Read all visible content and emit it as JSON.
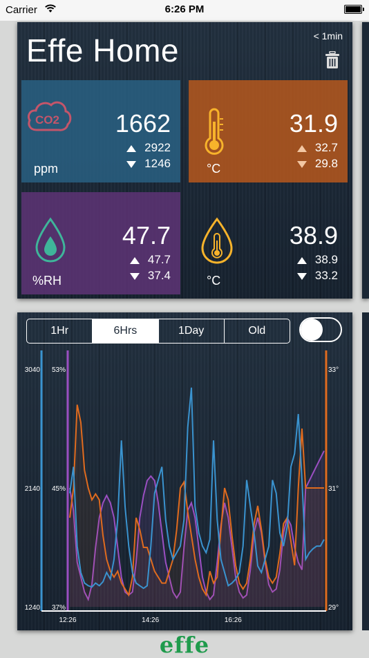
{
  "status": {
    "carrier": "Carrier",
    "time": "6:26 PM"
  },
  "app": {
    "title": "Effe Home",
    "refresh": "< 1min",
    "brand": "effe"
  },
  "tiles": {
    "co2": {
      "value": "1662",
      "high": "2922",
      "low": "1246",
      "unit": "ppm",
      "icon_label": "CO2"
    },
    "temp": {
      "value": "31.9",
      "high": "32.7",
      "low": "29.8",
      "unit": "°C"
    },
    "humidity": {
      "value": "47.7",
      "high": "47.7",
      "low": "37.4",
      "unit": "%RH"
    },
    "temp2": {
      "value": "38.9",
      "high": "38.9",
      "low": "33.2",
      "unit": "°C"
    }
  },
  "range": {
    "options": [
      "1Hr",
      "6Hrs",
      "1Day",
      "Old"
    ],
    "selected": "6Hrs"
  },
  "toggle": {
    "on": false
  },
  "colors": {
    "co2": "#3a93cf",
    "temp": "#e06b1e",
    "humidity": "#9b4fc2",
    "brand": "#1f9b4c"
  },
  "icons": [
    "wifi-icon",
    "battery-icon",
    "trash-icon",
    "co2-cloud-icon",
    "thermometer-icon",
    "water-drop-icon",
    "thermometer-drop-icon"
  ],
  "chart_data": {
    "type": "line",
    "y_left_co2": {
      "ticks": [
        "3040",
        "2140",
        "1240"
      ],
      "range": [
        1240,
        3040
      ]
    },
    "y_left_rh": {
      "ticks": [
        "53%",
        "45%",
        "37%"
      ],
      "range": [
        37,
        53
      ]
    },
    "y_right_temp": {
      "ticks": [
        "33°",
        "31°",
        "29°"
      ],
      "range": [
        29,
        33
      ]
    },
    "x_ticks": [
      "12:26",
      "14:26",
      "16:26"
    ],
    "series": [
      {
        "color": "#3a93cf",
        "values": [
          2100,
          2300,
          1700,
          1500,
          1420,
          1400,
          1390,
          1420,
          1400,
          1430,
          1500,
          1450,
          1600,
          1900,
          2500,
          2000,
          1700,
          1500,
          1420,
          1400,
          1380,
          1400,
          1700,
          2100,
          2200,
          2300,
          1900,
          1700,
          1600,
          1650,
          1700,
          1900,
          2600,
          2900,
          2000,
          1800,
          1700,
          1650,
          1750,
          2500,
          1900,
          1600,
          1500,
          1400,
          1420,
          1450,
          1500,
          1700,
          2200,
          2000,
          1800,
          1550,
          1500,
          1600,
          1700,
          2200,
          2100,
          1800,
          1700,
          1850,
          2300,
          2400,
          2700,
          2200,
          1600,
          1650,
          1680,
          1700,
          1700,
          1750
        ]
      },
      {
        "color": "#9b4fc2",
        "values": [
          45.0,
          43.5,
          40.0,
          39.0,
          38.0,
          37.5,
          38.5,
          41.0,
          43.0,
          44.0,
          44.5,
          44.0,
          43.0,
          41.0,
          39.0,
          38.0,
          37.8,
          38.0,
          40.0,
          43.0,
          44.5,
          45.5,
          45.8,
          45.5,
          44.0,
          42.0,
          40.0,
          39.0,
          38.0,
          37.6,
          38.0,
          41.0,
          43.5,
          44.0,
          43.0,
          41.0,
          39.0,
          38.0,
          37.5,
          37.8,
          40.0,
          42.5,
          44.0,
          43.0,
          41.0,
          39.0,
          38.0,
          37.6,
          37.8,
          39.5,
          42.0,
          43.0,
          42.0,
          40.0,
          38.5,
          38.0,
          38.2,
          39.5,
          42.0,
          43.0,
          42.5,
          41.0,
          40.0,
          39.5,
          45.0,
          45.5,
          46.0,
          46.5,
          47.0,
          47.5
        ]
      },
      {
        "color": "#e06b1e",
        "values": [
          30.5,
          31.0,
          32.4,
          32.1,
          31.3,
          31.0,
          30.8,
          30.9,
          30.8,
          30.2,
          29.8,
          29.6,
          29.5,
          29.6,
          29.4,
          29.3,
          29.2,
          29.5,
          30.5,
          30.3,
          30.0,
          30.0,
          29.8,
          29.6,
          29.5,
          29.4,
          29.4,
          29.6,
          29.8,
          30.3,
          31.0,
          31.1,
          30.6,
          30.2,
          29.8,
          29.5,
          29.3,
          29.2,
          29.6,
          29.4,
          29.5,
          30.3,
          31.0,
          30.8,
          30.2,
          29.7,
          29.4,
          29.3,
          29.4,
          29.8,
          30.4,
          30.7,
          30.3,
          29.8,
          29.5,
          29.4,
          29.5,
          29.9,
          30.4,
          30.5,
          30.1,
          29.7,
          31.0,
          32.0,
          31.0,
          31.0,
          31.0,
          31.0,
          31.0,
          31.0
        ]
      }
    ]
  }
}
